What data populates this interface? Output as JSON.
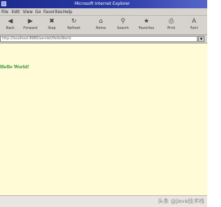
{
  "window": {
    "title": "Microsoft Internet Explorer"
  },
  "menu": {
    "items": [
      "File",
      "Edit",
      "View",
      "Go",
      "Favorites",
      "Help"
    ]
  },
  "toolbar": {
    "buttons": [
      {
        "label": "Back",
        "icon": "back-arrow-icon"
      },
      {
        "label": "Forward",
        "icon": "forward-arrow-icon"
      },
      {
        "label": "Stop",
        "icon": "stop-icon"
      },
      {
        "label": "Refresh",
        "icon": "refresh-icon"
      },
      {
        "label": "Home",
        "icon": "home-icon"
      },
      {
        "label": "Search",
        "icon": "search-icon"
      },
      {
        "label": "Favorites",
        "icon": "favorites-icon"
      },
      {
        "label": "Print",
        "icon": "print-icon"
      },
      {
        "label": "Font",
        "icon": "font-icon"
      }
    ]
  },
  "address": {
    "value": "http://localhost:8080/servlet/HelloWorld"
  },
  "content": {
    "text": "Hello World!"
  },
  "watermark": {
    "text": "头条 @Java技术栈"
  },
  "colors": {
    "title_bar": "#1c2c8c",
    "chrome": "#d6d3ce",
    "page_bg": "#fffbd6",
    "text": "#2f8f2f"
  }
}
